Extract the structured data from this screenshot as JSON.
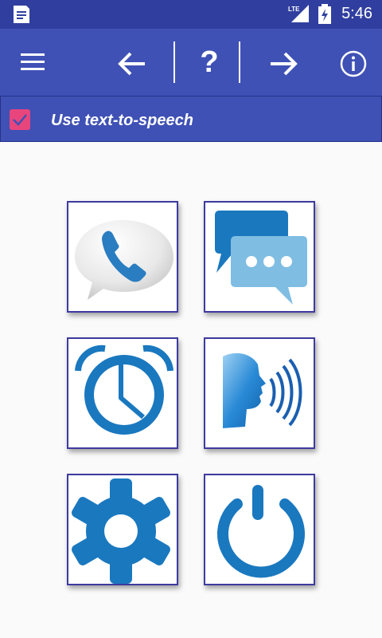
{
  "status_bar": {
    "time": "5:46",
    "network": "LTE",
    "icons": [
      "notification-icon",
      "signal-icon",
      "battery-icon"
    ]
  },
  "toolbar": {
    "icons": [
      "menu-icon",
      "back-arrow-icon",
      "help-icon",
      "forward-arrow-icon",
      "info-icon"
    ],
    "help_label": "?"
  },
  "tts": {
    "label": "Use text-to-speech",
    "checked": true
  },
  "tiles": [
    {
      "name": "phone-call-tile",
      "icon": "phone-bubble-icon"
    },
    {
      "name": "messages-tile",
      "icon": "chat-bubbles-icon"
    },
    {
      "name": "alarm-clock-tile",
      "icon": "alarm-clock-icon"
    },
    {
      "name": "speech-tile",
      "icon": "speaking-head-icon"
    },
    {
      "name": "settings-tile",
      "icon": "gear-icon"
    },
    {
      "name": "power-tile",
      "icon": "power-icon"
    }
  ],
  "colors": {
    "status_bar": "#303f9f",
    "toolbar": "#3f51b5",
    "checkbox": "#e8457d",
    "icon_blue": "#1a78bf",
    "tile_border": "#3e3a9f",
    "background": "#fafafa"
  }
}
